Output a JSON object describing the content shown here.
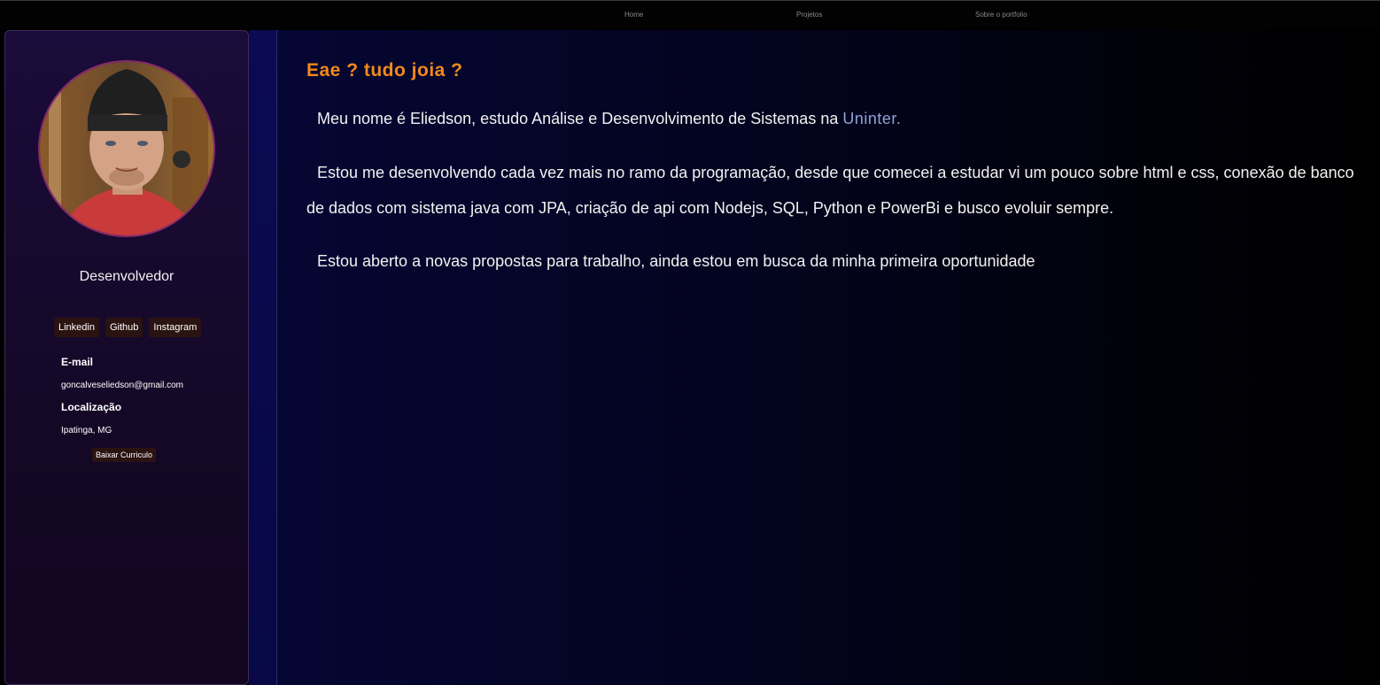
{
  "nav": {
    "home": "Home",
    "projetos": "Projetos",
    "sobre": "Sobre o portfolio"
  },
  "profile": {
    "role": "Desenvolvedor",
    "social": {
      "linkedin": "Linkedin",
      "github": "Github",
      "instagram": "Instagram"
    },
    "email_label": "E-mail",
    "email_value": "goncalveseliedson@gmail.com",
    "location_label": "Localização",
    "location_value": "Ipatinga, MG",
    "cv_button": "Baixar Curriculo"
  },
  "about": {
    "greeting": "Eae ? tudo joia ?",
    "p1_text": "Meu nome é Eliedson, estudo Análise e Desenvolvimento de Sistemas na ",
    "p1_link": "Uninter.",
    "p2_text": "Estou me desenvolvendo cada vez mais no ramo da programação, desde que comecei a estudar vi um pouco sobre html e css, conexão de banco de dados com sistema java com JPA, criação de api com Nodejs, SQL, Python e PowerBi e busco evoluir sempre.",
    "p3_text": "Estou aberto a novas propostas para trabalho, ainda estou em busca da minha primeira oportunidade"
  },
  "colors": {
    "accent_orange": "#f08a1c",
    "link_blue": "#8fa3d8",
    "button_bg": "#2a1311"
  }
}
